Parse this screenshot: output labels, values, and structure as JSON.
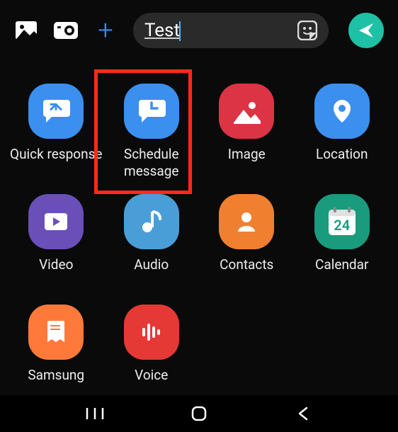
{
  "input": {
    "value": "Test"
  },
  "icons": {
    "gallery": "gallery-icon",
    "camera": "camera-icon",
    "plus": "plus-icon",
    "sticker": "sticker-icon",
    "send": "send-icon"
  },
  "grid": [
    {
      "label": "Quick response"
    },
    {
      "label": "Schedule message"
    },
    {
      "label": "Image"
    },
    {
      "label": "Location"
    },
    {
      "label": "Video"
    },
    {
      "label": "Audio"
    },
    {
      "label": "Contacts"
    },
    {
      "label": "Calendar"
    },
    {
      "label": "Samsung"
    },
    {
      "label": "Voice"
    }
  ],
  "calendar_day": "24",
  "highlighted_index": 1
}
